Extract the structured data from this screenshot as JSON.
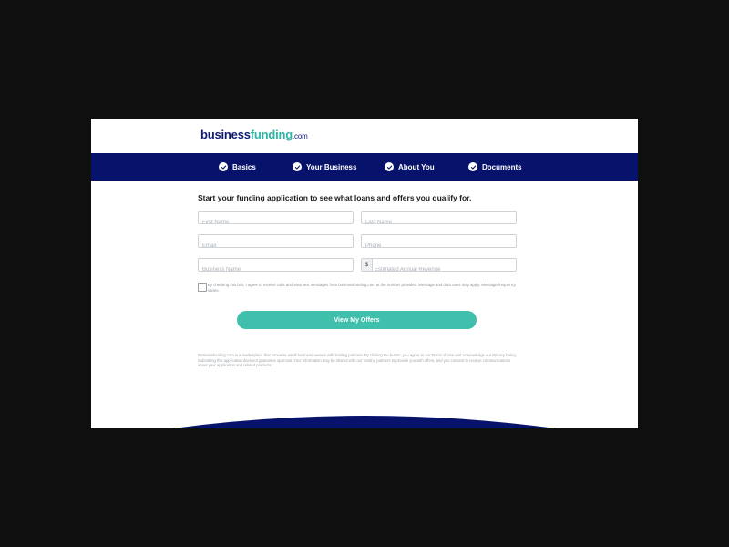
{
  "brand": {
    "name_part1": "business",
    "name_part2": "funding",
    "name_part3": ".com",
    "primary_color": "#07136b",
    "accent_color": "#40c0ac"
  },
  "steps": [
    {
      "label": "Basics",
      "status": "complete",
      "icon": "check-circle-icon"
    },
    {
      "label": "Your Business",
      "status": "complete",
      "icon": "check-circle-icon"
    },
    {
      "label": "About You",
      "status": "complete",
      "icon": "check-circle-icon"
    },
    {
      "label": "Documents",
      "status": "complete",
      "icon": "check-circle-icon"
    }
  ],
  "form": {
    "title": "Start your funding application to see what loans and offers you qualify for.",
    "first_name": {
      "placeholder": "First Name",
      "value": ""
    },
    "last_name": {
      "placeholder": "Last Name",
      "value": ""
    },
    "email": {
      "placeholder": "Email",
      "value": ""
    },
    "phone": {
      "placeholder": "Phone",
      "value": ""
    },
    "business_name": {
      "placeholder": "Business Name",
      "value": ""
    },
    "revenue": {
      "prefix": "$",
      "placeholder": "Estimated Annual Revenue",
      "value": ""
    },
    "consent_text": "By checking this box, I agree to receive calls and SMS text messages from businessfunding.com at the number provided. Message and data rates may apply. Message frequency varies.",
    "submit_label": "View My Offers"
  },
  "disclaimer": "Businessfunding.com is a marketplace that connects small business owners with lending partners. By clicking the button, you agree to our Terms of Use and acknowledge our Privacy Policy. Submitting this application does not guarantee approval. Your information may be shared with our lending partners to provide you with offers, and you consent to receive communications about your application and related products."
}
